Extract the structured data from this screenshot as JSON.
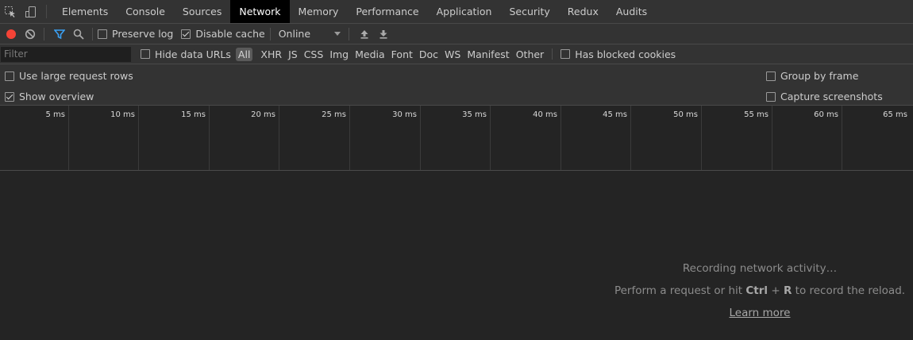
{
  "tabs": [
    {
      "label": "Elements"
    },
    {
      "label": "Console"
    },
    {
      "label": "Sources"
    },
    {
      "label": "Network",
      "active": true
    },
    {
      "label": "Memory"
    },
    {
      "label": "Performance"
    },
    {
      "label": "Application"
    },
    {
      "label": "Security"
    },
    {
      "label": "Redux"
    },
    {
      "label": "Audits"
    }
  ],
  "toolbar": {
    "record_icon": "record-icon",
    "clear_icon": "clear-icon",
    "filter_icon": "filter-icon",
    "search_icon": "search-icon",
    "preserve_log": {
      "label": "Preserve log",
      "checked": false
    },
    "disable_cache": {
      "label": "Disable cache",
      "checked": true
    },
    "throttling": "Online",
    "import_icon": "upload-icon",
    "export_icon": "download-icon",
    "record_color": "#f44336",
    "filter_color": "#3ba1f5"
  },
  "filterbar": {
    "placeholder": "Filter",
    "hide_data_urls": {
      "label": "Hide data URLs",
      "checked": false
    },
    "types": [
      "All",
      "XHR",
      "JS",
      "CSS",
      "Img",
      "Media",
      "Font",
      "Doc",
      "WS",
      "Manifest",
      "Other"
    ],
    "has_blocked_cookies": {
      "label": "Has blocked cookies",
      "checked": false
    }
  },
  "settings": {
    "large_rows": {
      "label": "Use large request rows",
      "checked": false
    },
    "show_overview": {
      "label": "Show overview",
      "checked": true
    },
    "group_by_frame": {
      "label": "Group by frame",
      "checked": false
    },
    "capture_screenshots": {
      "label": "Capture screenshots",
      "checked": false
    }
  },
  "overview": {
    "ticks": [
      "5 ms",
      "10 ms",
      "15 ms",
      "20 ms",
      "25 ms",
      "30 ms",
      "35 ms",
      "40 ms",
      "45 ms",
      "50 ms",
      "55 ms",
      "60 ms",
      "65 ms"
    ]
  },
  "empty_state": {
    "line1": "Recording network activity…",
    "line2_prefix": "Perform a request or hit ",
    "line2_key1": "Ctrl",
    "line2_plus": " + ",
    "line2_key2": "R",
    "line2_suffix": " to record the reload.",
    "learn_more": "Learn more"
  }
}
